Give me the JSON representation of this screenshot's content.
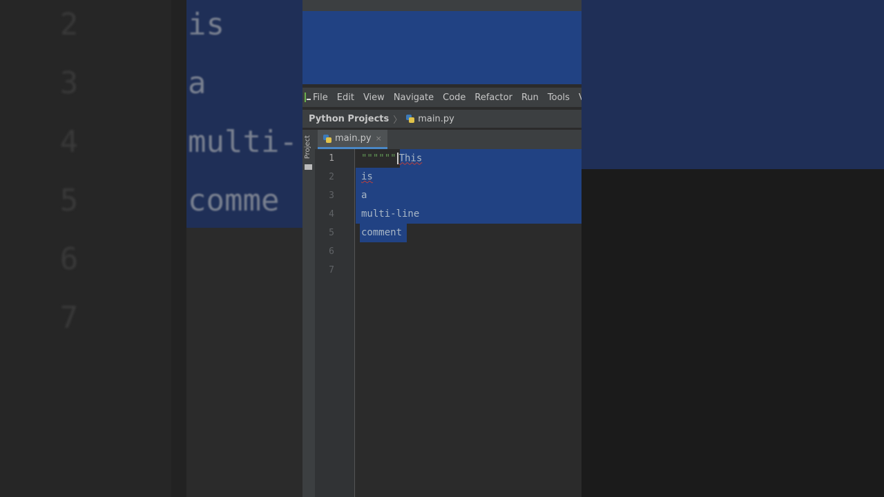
{
  "menu": [
    "File",
    "Edit",
    "View",
    "Navigate",
    "Code",
    "Refactor",
    "Run",
    "Tools",
    "V"
  ],
  "breadcrumb": {
    "project": "Python Projects",
    "file": "main.py"
  },
  "sidebar_label": "Project",
  "tab": {
    "label": "main.py",
    "close": "×"
  },
  "gutter_lines": [
    "1",
    "2",
    "3",
    "4",
    "5",
    "6",
    "7"
  ],
  "code": {
    "quotes": "\"\"\"\"\"\"",
    "line1": "This",
    "line2": "is",
    "line3": "a",
    "line4": "multi-line",
    "line5": "comment"
  },
  "bg": {
    "nums": [
      "2",
      "3",
      "4",
      "5",
      "6",
      "7"
    ],
    "code": [
      "is",
      "a",
      "multi-",
      "comme"
    ]
  },
  "colors": {
    "selection": "#214283",
    "background": "#2b2b2b",
    "menubar": "#3c3f41",
    "tab_underline": "#4a88c7"
  }
}
